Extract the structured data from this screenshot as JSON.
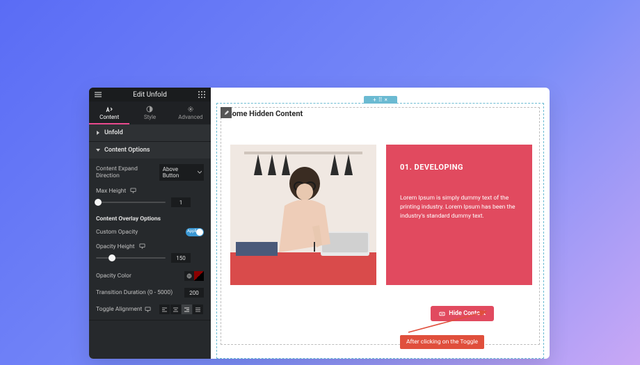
{
  "header": {
    "title": "Edit Unfold"
  },
  "tabs": {
    "content": "Content",
    "style": "Style",
    "advanced": "Advanced"
  },
  "sections": {
    "unfold": "Unfold",
    "content_options": "Content Options"
  },
  "fields": {
    "expand_dir_label": "Content Expand Direction",
    "expand_dir_value": "Above Button",
    "max_height_label": "Max Height",
    "max_height_value": "1",
    "overlay_heading": "Content Overlay Options",
    "custom_opacity_label": "Custom Opacity",
    "custom_opacity_state": "Applied",
    "opacity_height_label": "Opacity Height",
    "opacity_height_value": "150",
    "opacity_color_label": "Opacity Color",
    "transition_label": "Transition Duration (0 - 5000)",
    "transition_value": "200",
    "toggle_align_label": "Toggle Alignment"
  },
  "canvas": {
    "hidden_title": "Some Hidden Content",
    "card_title": "01. DEVELOPING",
    "card_text": "Lorem Ipsum is simply dummy text of the printing industry. Lorem Ipsum has been the industry's standard dummy text.",
    "hide_button": "Hide Content",
    "tip": "After clicking on the Toggle"
  },
  "colors": {
    "accent": "#e14a5f",
    "arrow": "#e04f3c",
    "section_border": "#6bbad2"
  }
}
